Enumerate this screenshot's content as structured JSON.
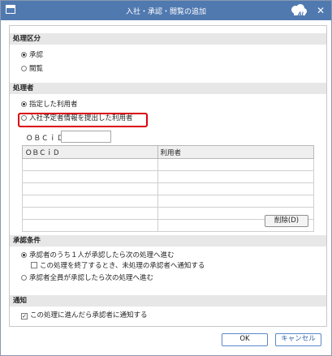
{
  "window": {
    "title": "入社・承認・閲覧の追加"
  },
  "section1": {
    "header": "処理区分",
    "options": [
      "承認",
      "閲覧"
    ],
    "selected": "承認"
  },
  "section2": {
    "header": "処理者",
    "options": [
      "指定した利用者",
      "入社予定者情報を提出した利用者"
    ],
    "selected": "指定した利用者",
    "obcid_label": "ＯＢＣｉＤ",
    "obcid_value": "",
    "table": {
      "columns": [
        "ＯＢＣｉＤ",
        "利用者"
      ],
      "rows": [
        [
          "",
          ""
        ],
        [
          "",
          ""
        ],
        [
          "",
          ""
        ],
        [
          "",
          ""
        ],
        [
          "",
          ""
        ],
        [
          "",
          ""
        ]
      ]
    },
    "delete_label": "削除(D)"
  },
  "section3": {
    "header": "承認条件",
    "option1": "承認者のうち１人が承認したら次の処理へ進む",
    "sub_checkbox": "この処理を終了するとき、未処理の承認者へ通知する",
    "sub_checked": false,
    "option2": "承認者全員が承認したら次の処理へ進む",
    "selected": "option1"
  },
  "section4": {
    "header": "通知",
    "checkbox": "この処理に進んだら承認者に通知する",
    "checked": true
  },
  "footer": {
    "ok_label": "OK",
    "cancel_label": "キャンセル"
  },
  "colors": {
    "titlebar": "#5079b0",
    "highlight": "#d9000d"
  },
  "icons": {
    "app": "window-icon",
    "ai": "ai-cloud-badge",
    "close": "close-icon"
  }
}
